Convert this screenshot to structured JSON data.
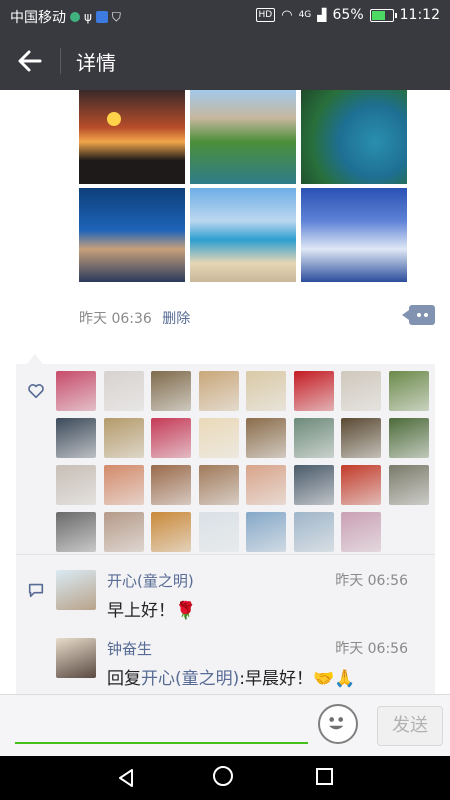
{
  "statusbar": {
    "carrier": "中国移动",
    "hd": "HD",
    "network": "4G",
    "battery_percent": "65%",
    "battery_level": 0.65,
    "time": "11:12"
  },
  "header": {
    "title": "详情"
  },
  "post": {
    "time": "昨天 06:36",
    "delete_label": "删除"
  },
  "likes": {
    "avatar_colors": [
      "#c74b6a",
      "#d7d2cf",
      "#7f6b4b",
      "#c9a77a",
      "#d9c9a5",
      "#c41c24",
      "#cfc8bc",
      "#6c8a4b",
      "#3c4a5a",
      "#b49a6a",
      "#c53a57",
      "#ead9b8",
      "#8a6c4a",
      "#6d8a7a",
      "#5a4a32",
      "#4d6b3a",
      "#c8bfb6",
      "#d38a6a",
      "#9a6a4a",
      "#a07a5a",
      "#d8a48a",
      "#4a5a6a",
      "#c23b2a",
      "#7a7a6a",
      "#6a6a6a",
      "#b59a88",
      "#c9893a",
      "#d9e1e6",
      "#85a8c8",
      "#9fb6ca",
      "#c9a0b4"
    ]
  },
  "comments": [
    {
      "name": "开心(童之明)",
      "time": "昨天 06:56",
      "text": "早上好！🌹"
    },
    {
      "name": "钟奋生",
      "time": "昨天 06:56",
      "prefix": "回复",
      "mention": "开心(童之明)",
      "text": ":早晨好！🤝🙏"
    }
  ],
  "input": {
    "send_label": "发送"
  }
}
